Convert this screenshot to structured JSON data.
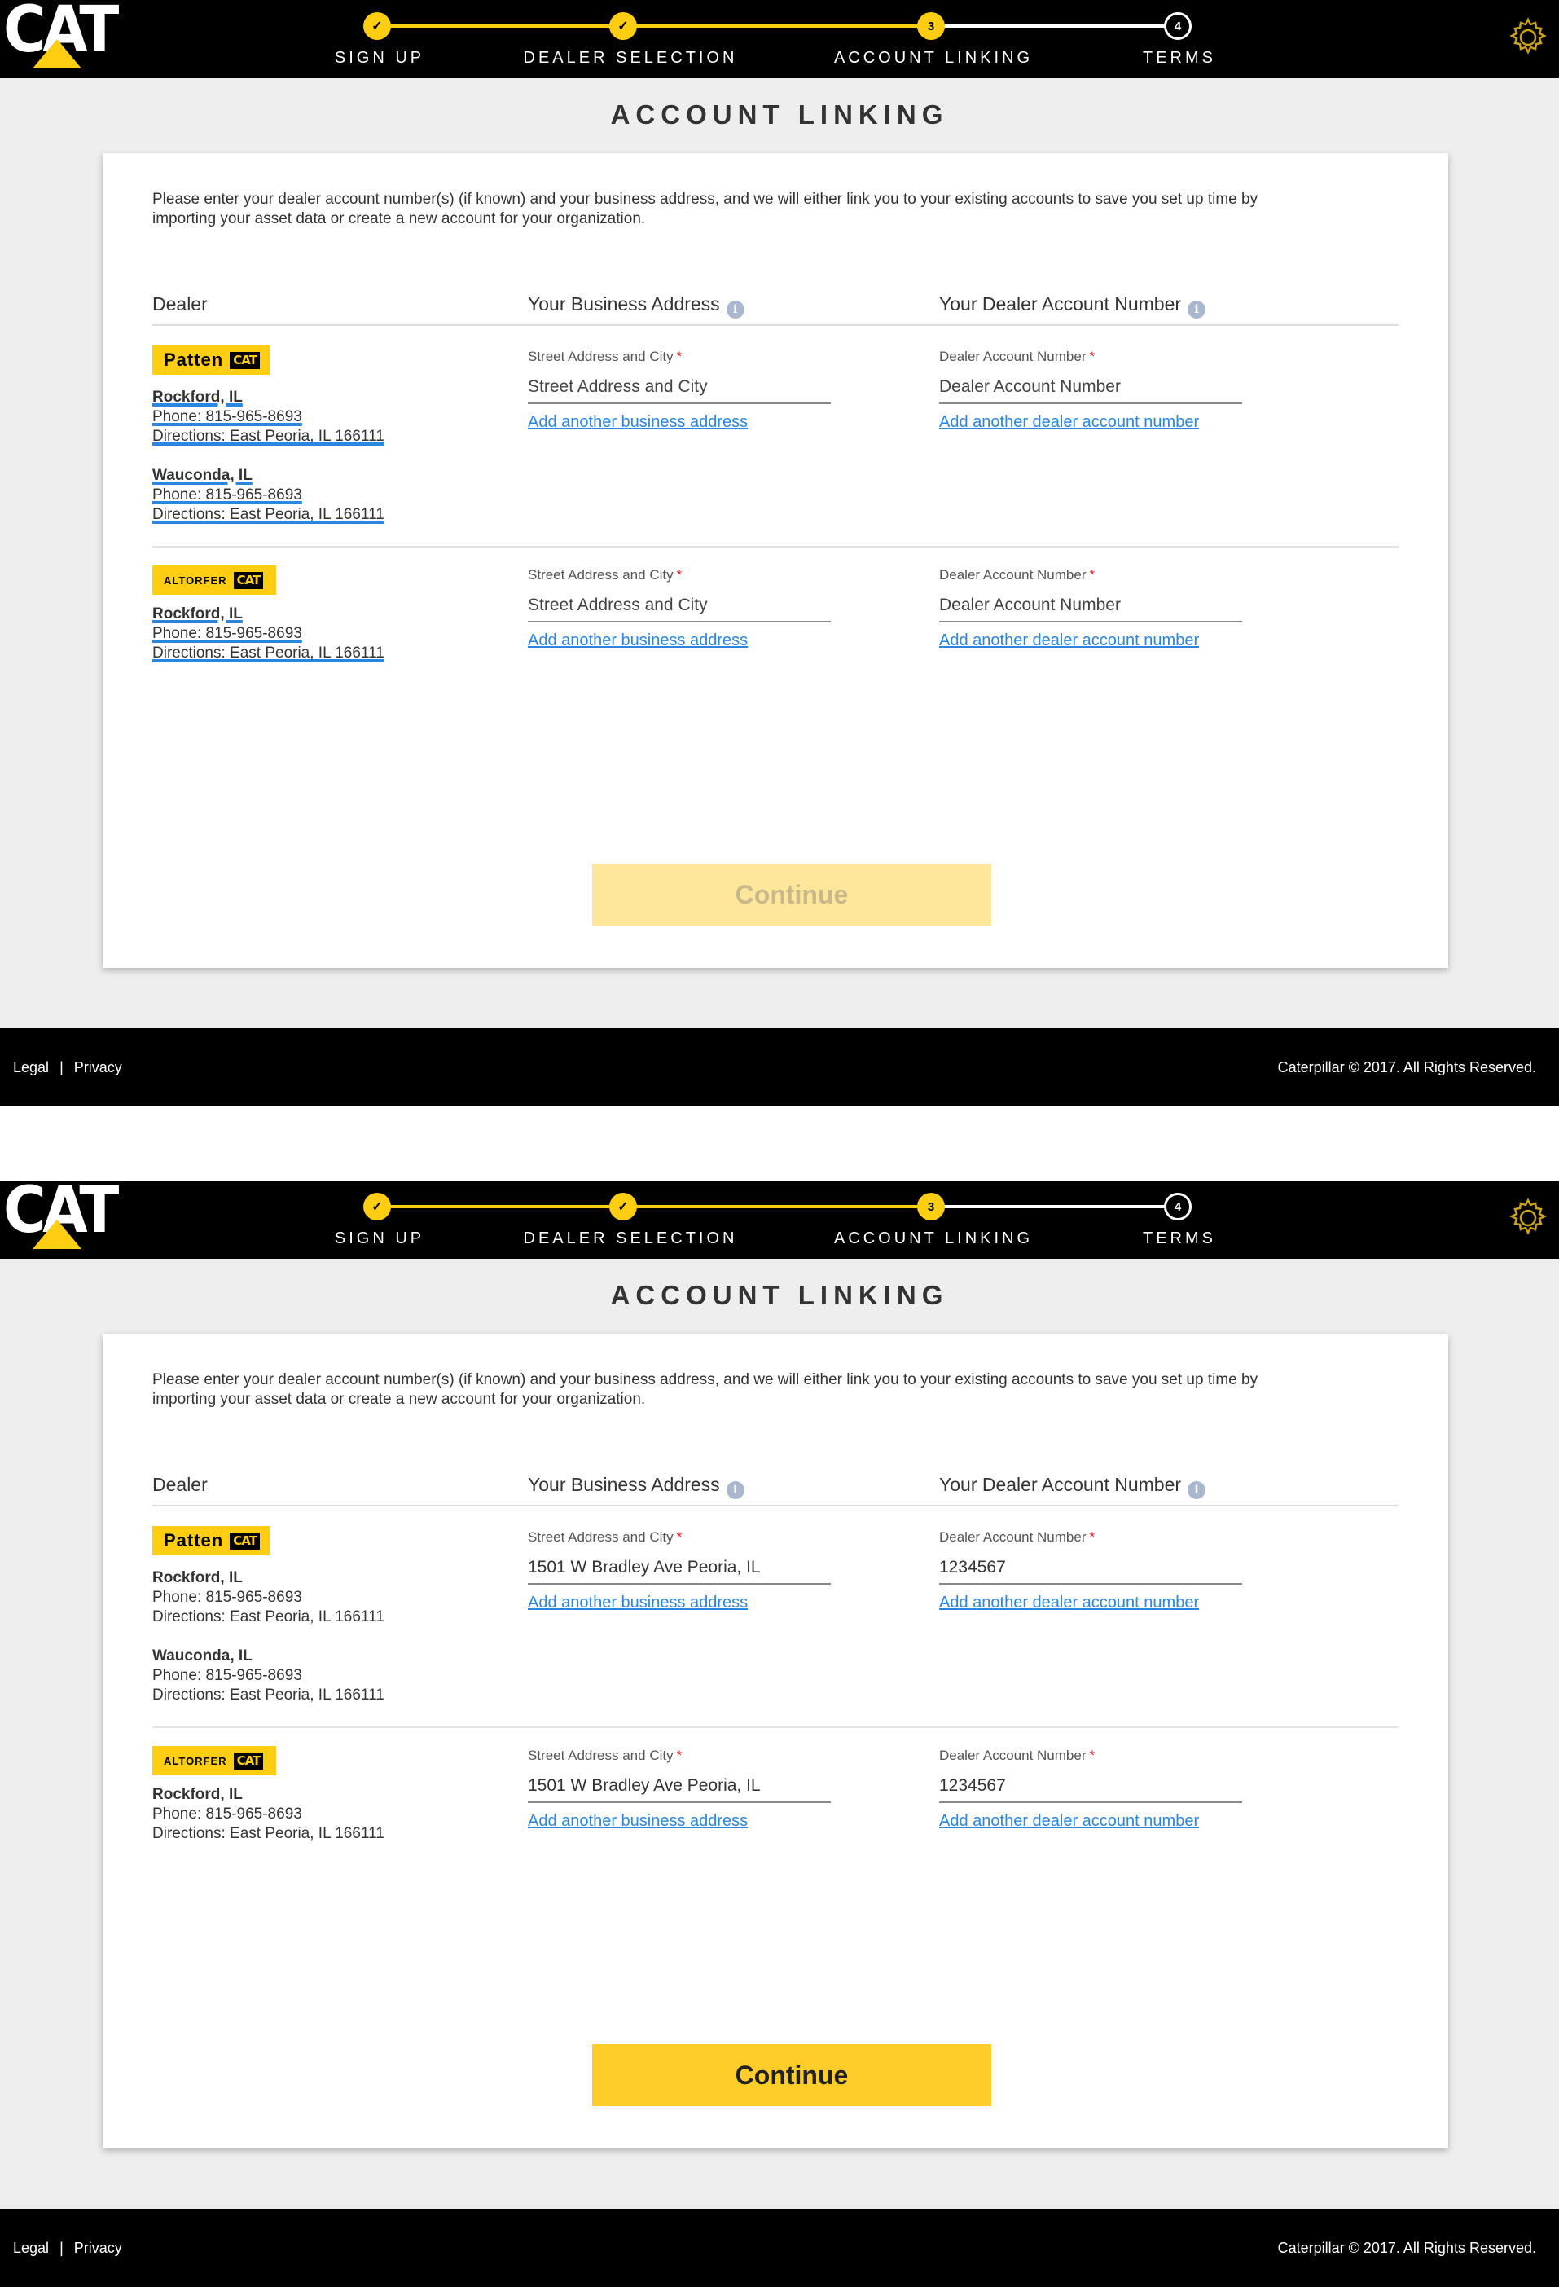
{
  "brand": {
    "logo_text": "CAT",
    "reg_mark": "®",
    "accent_color": "#ffcd11",
    "link_color": "#2a86e0"
  },
  "stepper": {
    "steps": [
      {
        "label": "SIGN UP",
        "state": "done",
        "marker": "✓"
      },
      {
        "label": "DEALER SELECTION",
        "state": "done",
        "marker": "✓"
      },
      {
        "label": "ACCOUNT LINKING",
        "state": "current",
        "marker": "3"
      },
      {
        "label": "TERMS",
        "state": "todo",
        "marker": "4"
      }
    ]
  },
  "settings_icon": "gear-icon",
  "page": {
    "title": "ACCOUNT LINKING",
    "intro_line1": "Please enter your dealer account number(s) (if known) and your business address, and we will either link you to your existing accounts to save you set up time by",
    "intro_line2": "importing your asset data or create a new account for your organization."
  },
  "columns": {
    "dealer": "Dealer",
    "address": "Your Business Address",
    "account": "Your Dealer Account Number",
    "info_icon": "i"
  },
  "fields": {
    "address_label": "Street Address and City",
    "address_placeholder": "Street Address and City",
    "account_label": "Dealer Account Number",
    "account_placeholder": "Dealer Account Number",
    "required_mark": "*",
    "add_address": "Add another business address",
    "add_account": "Add another dealer account number"
  },
  "dealers": [
    {
      "name": "Patten",
      "cat_box": "CAT",
      "locations": [
        {
          "city": "Rockford, IL",
          "phone": "Phone: 815-965-8693",
          "directions": "Directions: East Peoria, IL 166111"
        },
        {
          "city": "Wauconda, IL",
          "phone": "Phone: 815-965-8693",
          "directions": "Directions: East Peoria, IL 166111"
        }
      ]
    },
    {
      "name": "ALTORFER",
      "cat_box": "CAT",
      "locations": [
        {
          "city": "Rockford, IL",
          "phone": "Phone: 815-965-8693",
          "directions": "Directions: East Peoria, IL 166111"
        }
      ]
    }
  ],
  "screens": {
    "empty": {
      "address_value": "",
      "account_value": "",
      "continue_state": "disabled"
    },
    "filled": {
      "address_value": "1501 W Bradley Ave Peoria, IL",
      "account_value": "1234567",
      "continue_state": "enabled"
    }
  },
  "continue_label": "Continue",
  "footer": {
    "legal": "Legal",
    "separator": "|",
    "privacy": "Privacy",
    "copyright": "Caterpillar © 2017. All Rights Reserved."
  }
}
